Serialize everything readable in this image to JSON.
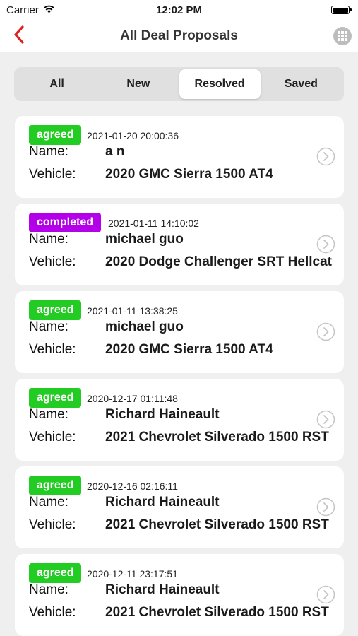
{
  "status_bar": {
    "carrier": "Carrier",
    "time": "12:02 PM"
  },
  "nav": {
    "title": "All Deal Proposals",
    "back_icon": "chevron-left-icon",
    "menu_icon": "grid-icon",
    "accent_color": "#e02020"
  },
  "tabs": [
    {
      "label": "All",
      "active": false
    },
    {
      "label": "New",
      "active": false
    },
    {
      "label": "Resolved",
      "active": true
    },
    {
      "label": "Saved",
      "active": false
    }
  ],
  "labels": {
    "name": "Name:",
    "vehicle": "Vehicle:"
  },
  "deals": [
    {
      "status": "agreed",
      "timestamp": "2021-01-20 20:00:36",
      "name": "a n",
      "vehicle": "2020 GMC Sierra 1500 AT4"
    },
    {
      "status": "completed",
      "timestamp": "2021-01-11 14:10:02",
      "name": "michael guo",
      "vehicle": "2020 Dodge Challenger SRT Hellcat"
    },
    {
      "status": "agreed",
      "timestamp": "2021-01-11 13:38:25",
      "name": "michael guo",
      "vehicle": "2020 GMC Sierra 1500 AT4"
    },
    {
      "status": "agreed",
      "timestamp": "2020-12-17 01:11:48",
      "name": "Richard Haineault",
      "vehicle": "2021 Chevrolet Silverado 1500 RST"
    },
    {
      "status": "agreed",
      "timestamp": "2020-12-16 02:16:11",
      "name": "Richard Haineault",
      "vehicle": "2021 Chevrolet Silverado 1500 RST"
    },
    {
      "status": "agreed",
      "timestamp": "2020-12-11 23:17:51",
      "name": "Richard Haineault",
      "vehicle": "2021 Chevrolet Silverado 1500 RST"
    }
  ],
  "colors": {
    "agreed": "#22cc22",
    "completed": "#b400e8"
  }
}
